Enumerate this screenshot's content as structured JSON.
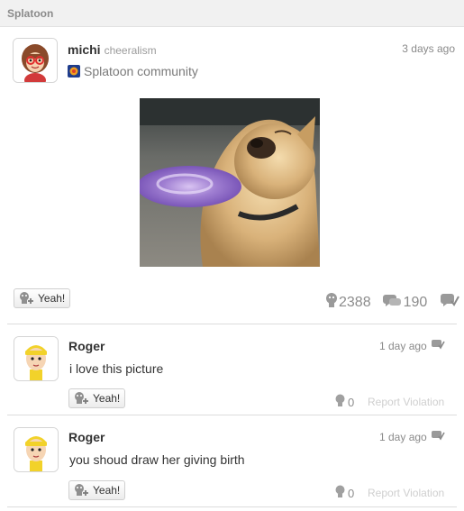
{
  "header": {
    "title": "Splatoon"
  },
  "post": {
    "author": "michi",
    "author_sub": "cheeralism",
    "time": "3 days ago",
    "community": "Splatoon community",
    "yeah_label": "Yeah!",
    "yeah_count": "2388",
    "comment_count": "190",
    "colors": {
      "community_icon": "#e0a020"
    }
  },
  "comments": [
    {
      "author": "Roger",
      "time": "1 day ago",
      "text": "i love this picture",
      "yeah_label": "Yeah!",
      "yeah_count": "0",
      "report_label": "Report Violation"
    },
    {
      "author": "Roger",
      "time": "1 day ago",
      "text": "you shoud draw her giving birth",
      "yeah_label": "Yeah!",
      "yeah_count": "0",
      "report_label": "Report Violation"
    }
  ]
}
